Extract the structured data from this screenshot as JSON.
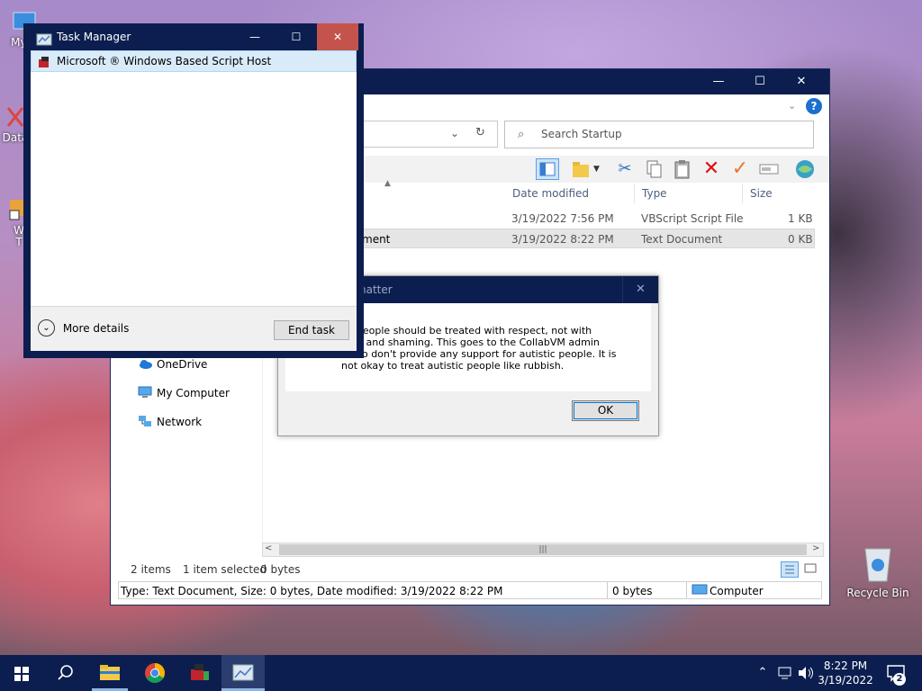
{
  "desktop": {
    "icons": [
      {
        "label": "My C"
      },
      {
        "label": "Data"
      },
      {
        "label": "W\nT"
      }
    ],
    "recycle_bin": {
      "label": "Recycle Bin"
    }
  },
  "explorer": {
    "search_placeholder": "Search Startup",
    "columns": {
      "date_modified": "Date modified",
      "type": "Type",
      "size": "Size"
    },
    "files": [
      {
        "name": "",
        "date": "3/19/2022 7:56 PM",
        "type": "VBScript Script File",
        "size": "1 KB"
      },
      {
        "name": "ment",
        "date": "3/19/2022 8:22 PM",
        "type": "Text Document",
        "size": "0 KB"
      }
    ],
    "nav": [
      {
        "label": "OneDrive"
      },
      {
        "label": "My Computer"
      },
      {
        "label": "Network"
      }
    ],
    "status": {
      "items": "2 items",
      "selected": "1 item selected",
      "bytes": "0 bytes"
    },
    "details_bar": {
      "info": "Type: Text Document, Size: 0 bytes, Date modified: 3/19/2022 8:22 PM",
      "bytes": "0 bytes",
      "location": "Computer"
    }
  },
  "dialog": {
    "title_fragment": "natter",
    "message": "tic people should be treated with respect, not with\n  ing and shaming. This goes to the CollabVM admin\n  who don't provide any support for autistic people. It is\nnot okay to treat autistic people like rubbish.",
    "ok_label": "OK"
  },
  "task_manager": {
    "title": "Task Manager",
    "process": "Microsoft ® Windows Based Script Host",
    "more_details": "More details",
    "end_task": "End task"
  },
  "taskbar": {
    "time": "8:22 PM",
    "date": "3/19/2022",
    "notification_count": "2"
  },
  "colors": {
    "titlebar": "#0b1e4f",
    "close_hover": "#c4534b",
    "selection": "#d9ebf9",
    "accent": "#0078d7"
  }
}
